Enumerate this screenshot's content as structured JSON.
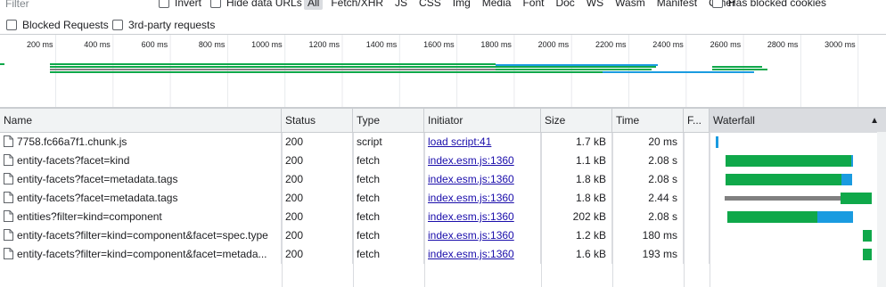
{
  "filter": {
    "placeholder": "Filter"
  },
  "filter_row": {
    "invert": "Invert",
    "hide_data_urls": "Hide data URLs",
    "types": [
      "All",
      "Fetch/XHR",
      "JS",
      "CSS",
      "Img",
      "Media",
      "Font",
      "Doc",
      "WS",
      "Wasm",
      "Manifest",
      "Other"
    ],
    "active_type": "All",
    "has_blocked_cookies": "Has blocked cookies"
  },
  "second_row": {
    "blocked_requests": "Blocked Requests",
    "third_party": "3rd-party requests"
  },
  "overview": {
    "ticks": [
      "200 ms",
      "400 ms",
      "600 ms",
      "800 ms",
      "1000 ms",
      "1200 ms",
      "1400 ms",
      "1600 ms",
      "1800 ms",
      "2000 ms",
      "2200 ms",
      "2400 ms",
      "2600 ms",
      "2800 ms",
      "3000 ms"
    ]
  },
  "table": {
    "columns": [
      "Name",
      "Status",
      "Type",
      "Initiator",
      "Size",
      "Time",
      "F...",
      "Waterfall"
    ],
    "rows": [
      {
        "name": "7758.fc66a7f1.chunk.js",
        "status": "200",
        "type": "script",
        "initiator": "load script:41",
        "size": "1.7 kB",
        "time": "20 ms",
        "f": ""
      },
      {
        "name": "entity-facets?facet=kind",
        "status": "200",
        "type": "fetch",
        "initiator": "index.esm.js:1360",
        "size": "1.1 kB",
        "time": "2.08 s",
        "f": ""
      },
      {
        "name": "entity-facets?facet=metadata.tags",
        "status": "200",
        "type": "fetch",
        "initiator": "index.esm.js:1360",
        "size": "1.8 kB",
        "time": "2.08 s",
        "f": ""
      },
      {
        "name": "entity-facets?facet=metadata.tags",
        "status": "200",
        "type": "fetch",
        "initiator": "index.esm.js:1360",
        "size": "1.8 kB",
        "time": "2.44 s",
        "f": ""
      },
      {
        "name": "entities?filter=kind=component",
        "status": "200",
        "type": "fetch",
        "initiator": "index.esm.js:1360",
        "size": "202 kB",
        "time": "2.08 s",
        "f": ""
      },
      {
        "name": "entity-facets?filter=kind=component&facet=spec.type",
        "status": "200",
        "type": "fetch",
        "initiator": "index.esm.js:1360",
        "size": "1.2 kB",
        "time": "180 ms",
        "f": ""
      },
      {
        "name": "entity-facets?filter=kind=component&facet=metada...",
        "status": "200",
        "type": "fetch",
        "initiator": "index.esm.js:1360",
        "size": "1.6 kB",
        "time": "193 ms",
        "f": ""
      }
    ]
  },
  "colors": {
    "waiting": "#0fa84a",
    "download": "#1a9be0",
    "queued": "#808080",
    "selection": "#dadce0"
  }
}
